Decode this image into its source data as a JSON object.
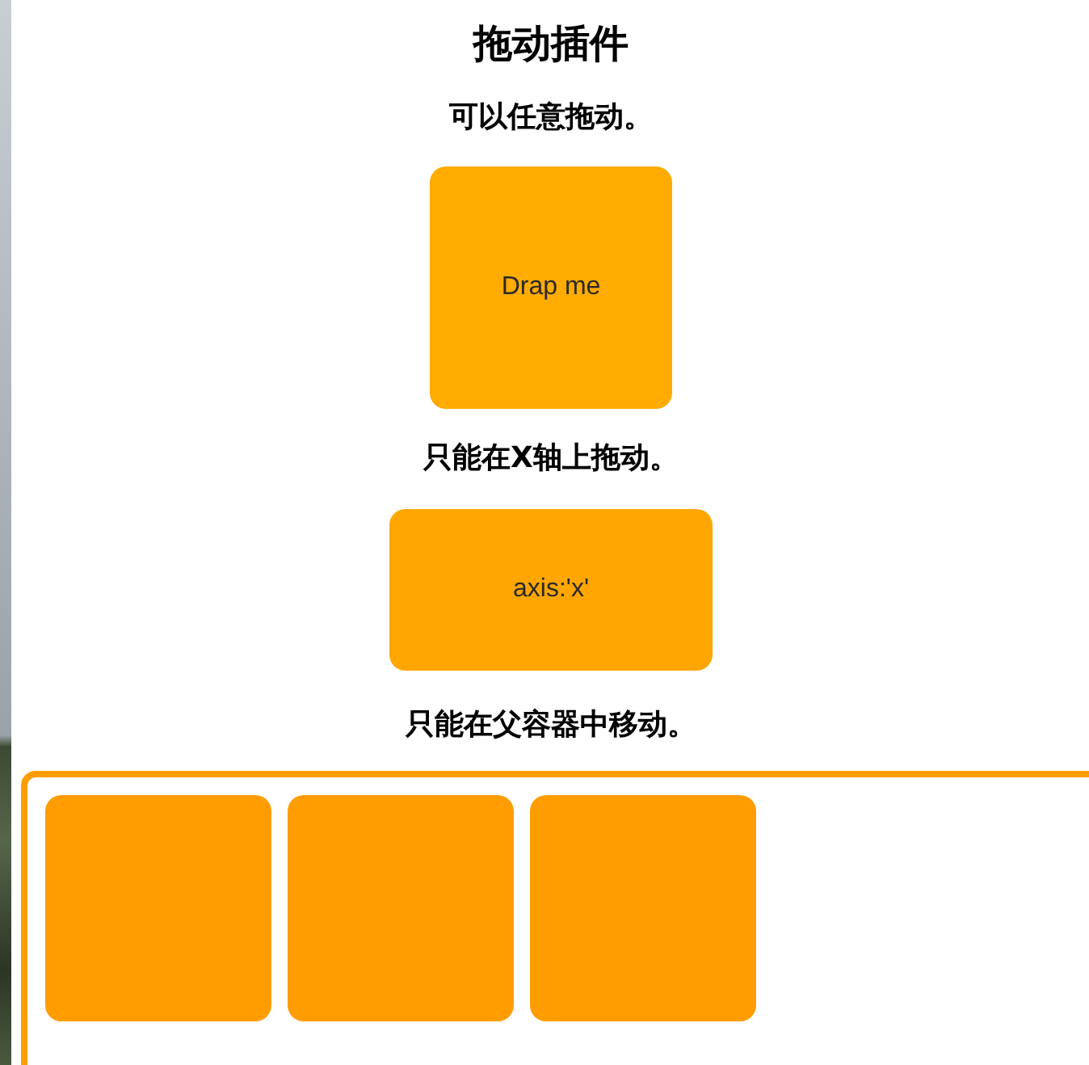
{
  "page": {
    "title": "拖动插件"
  },
  "sections": [
    {
      "kind": "free",
      "heading": "可以任意拖动。",
      "boxes": [
        {
          "kind": "labeled",
          "label": "Drap me"
        }
      ]
    },
    {
      "kind": "axis",
      "heading": "只能在X轴上拖动。",
      "boxes": [
        {
          "kind": "labeled",
          "label": "axis:'x'"
        }
      ]
    },
    {
      "kind": "contained",
      "heading": "只能在父容器中移动。",
      "boxes": [
        {
          "kind": "blank"
        },
        {
          "kind": "blank"
        },
        {
          "kind": "blank"
        }
      ]
    }
  ]
}
